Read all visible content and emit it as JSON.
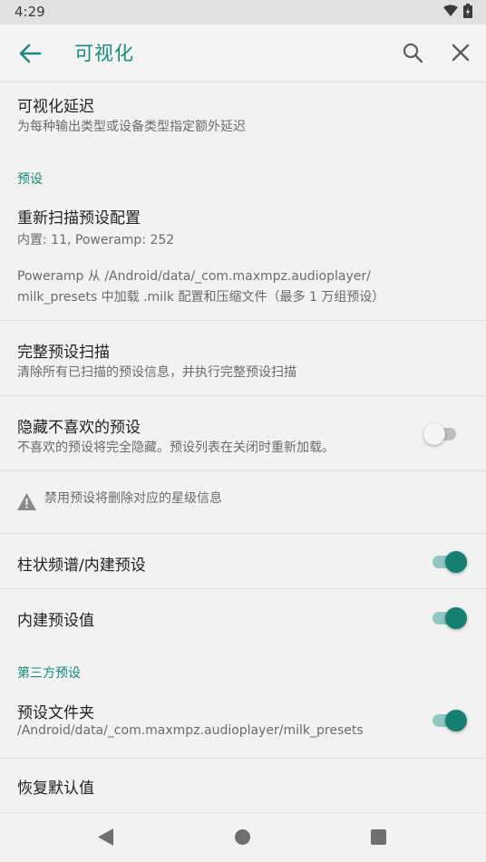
{
  "status": {
    "time": "4:29"
  },
  "toolbar": {
    "title": "可视化"
  },
  "items": {
    "viz_delay": {
      "title": "可视化延迟",
      "summary": "为每种输出类型或设备类型指定额外延迟"
    },
    "section_presets": "预设",
    "rescan": {
      "title": "重新扫描预设配置",
      "summary": "内置: 11, Poweramp: 252",
      "desc_line1": "Poweramp 从 /Android/data/_com.maxmpz.audioplayer/",
      "desc_line2": "milk_presets 中加载 .milk 配置和压缩文件（最多 1 万组预设）"
    },
    "full_scan": {
      "title": "完整预设扫描",
      "summary": "清除所有已扫描的预设信息，并执行完整预设扫描"
    },
    "hide_disliked": {
      "title": "隐藏不喜欢的预设",
      "summary": "不喜欢的预设将完全隐藏。预设列表在关闭时重新加载。",
      "enabled": false
    },
    "warning": "禁用预设将删除对应的星级信息",
    "bar_spectrum": {
      "title": "柱状频谱/内建预设",
      "enabled": true
    },
    "builtin_values": {
      "title": "内建预设值",
      "enabled": true
    },
    "section_third_party": "第三方预设",
    "preset_folder": {
      "title": "预设文件夹",
      "summary": "/Android/data/_com.maxmpz.audioplayer/milk_presets",
      "enabled": true
    },
    "restore_defaults": {
      "title": "恢复默认值"
    }
  },
  "colors": {
    "accent": "#178b7f",
    "toggle_on": "#157f74"
  }
}
